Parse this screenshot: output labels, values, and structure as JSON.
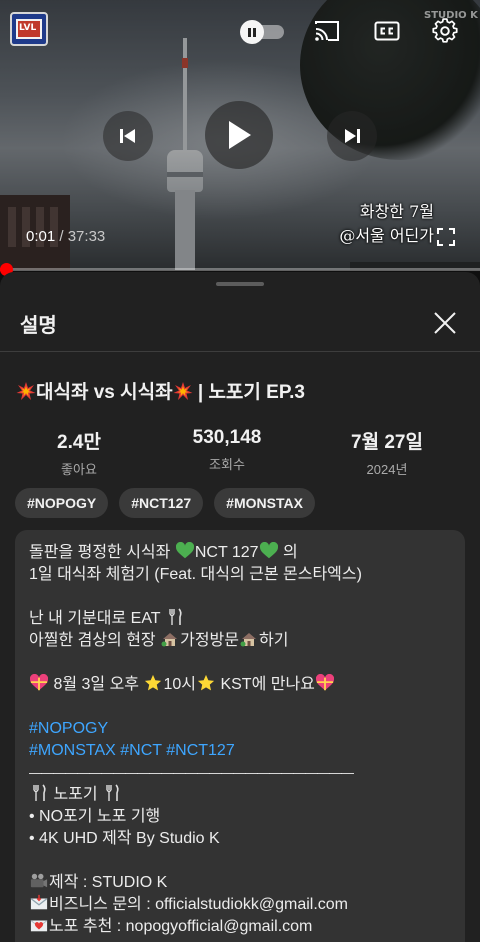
{
  "player": {
    "current_time": "0:01",
    "separator": " / ",
    "duration": "37:33",
    "overlay_caption_line1": "화창한 7월",
    "overlay_caption_line2": "@서울 어딘가",
    "watermark": "STUDIO K",
    "progress_fraction": 0.0004,
    "accent_color": "#ff0000"
  },
  "sheet": {
    "title": "설명"
  },
  "video": {
    "title": "대식좌 vs 시식좌",
    "title_suffix": " | 노포기 EP.3"
  },
  "stats": [
    {
      "value": "2.4만",
      "label": "좋아요"
    },
    {
      "value": "530,148",
      "label": "조회수"
    },
    {
      "value": "7월 27일",
      "label": "2024년"
    }
  ],
  "tags": [
    "#NOPOGY",
    "#NCT127",
    "#MONSTAX"
  ],
  "description": {
    "l1_a": "돌판을 평정한 시식좌 ",
    "l1_b": "NCT 127",
    "l1_c": " 의",
    "l2": "1일 대식좌 체험기 (Feat. 대식의 근본 몬스타엑스)",
    "l3": "난 내 기분대로 EAT ",
    "l4_a": "아찔한 겸상의 현장 ",
    "l4_b": "가정방문",
    "l4_c": "하기",
    "l5_a": " 8월 3일 오후 ",
    "l5_b": "10시",
    "l5_c": " KST에 만나요",
    "hashtag_1": "#NOPOGY",
    "hashtag_2": "#MONSTAX",
    "hashtag_3": "#NCT",
    "hashtag_4": "#NCT127",
    "divider": "———————————————————————————",
    "section_title": " 노포기 ",
    "bullet_1": "•  NO포기 노포 기행",
    "bullet_2": "•  4K UHD 제작 By Studio K",
    "credit_1": "제작 : STUDIO K",
    "credit_2": "비즈니스 문의 : officialstudiokk@gmail.com",
    "credit_3": "노포 추천 : nopogyofficial@gmail.com"
  },
  "colors": {
    "background": "#0f0f0f",
    "sheet": "#212121",
    "desc_box": "#333333",
    "link": "#3ea6ff",
    "heart_green": "#4caf50"
  },
  "icons": [
    "pause-icon",
    "cast-icon",
    "closed-captions-icon",
    "settings-gear-icon",
    "previous-icon",
    "play-icon",
    "next-icon",
    "fullscreen-icon",
    "close-icon"
  ]
}
